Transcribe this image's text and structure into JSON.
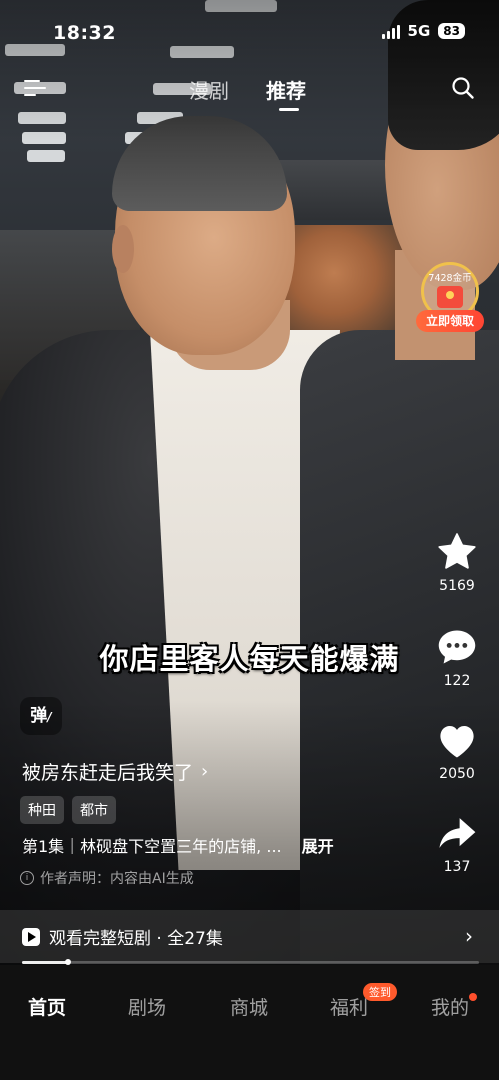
{
  "status_bar": {
    "time": "18:32",
    "network": "5G",
    "battery": "83"
  },
  "top_nav": {
    "tabs": [
      {
        "label": "漫剧",
        "active": false
      },
      {
        "label": "推荐",
        "active": true
      }
    ]
  },
  "reward": {
    "amount": "7428金币",
    "button": "立即领取"
  },
  "video": {
    "subtitle": "你店里客人每天能爆满",
    "danmu_label": "弹",
    "title": "被房东赶走后我笑了",
    "tags": [
      "种田",
      "都市"
    ],
    "episode_text": "第1集｜林砚盘下空置三年的店铺, ...",
    "expand_label": "展开",
    "ai_note": "作者声明：内容由AI生成",
    "progress": 0.1
  },
  "actions": {
    "favorite_count": "5169",
    "comment_count": "122",
    "like_count": "2050",
    "share_count": "137"
  },
  "watch_bar": {
    "label": "观看完整短剧 · 全27集"
  },
  "bottom_nav": {
    "items": [
      "首页",
      "剧场",
      "商城",
      "福利",
      "我的"
    ],
    "active_index": 0,
    "badge": "签到"
  },
  "colors": {
    "accent": "#ff5a2c",
    "reward_ring": "#f0c14b"
  }
}
